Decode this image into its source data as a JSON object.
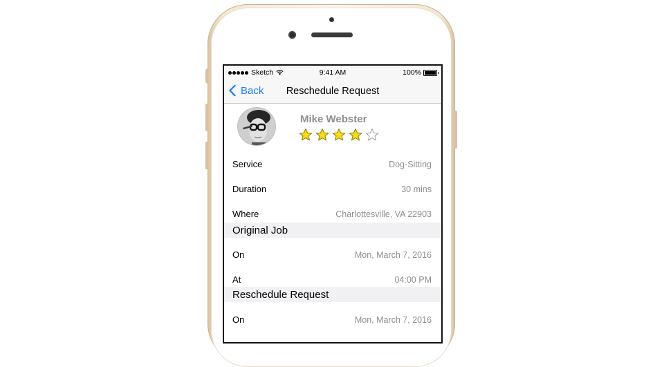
{
  "status_bar": {
    "carrier": "Sketch",
    "time": "9:41 AM",
    "battery": "100%"
  },
  "nav": {
    "back_label": "Back",
    "title": "Reschedule Request"
  },
  "profile": {
    "name": "Mike Webster",
    "rating": 4,
    "rating_max": 5,
    "star_color": "#f5de19"
  },
  "details": [
    {
      "label": "Service",
      "value": "Dog-Sitting"
    },
    {
      "label": "Duration",
      "value": "30 mins"
    },
    {
      "label": "Where",
      "value": "Charlottesville, VA 22903"
    }
  ],
  "original_job": {
    "header": "Original Job",
    "rows": [
      {
        "label": "On",
        "value": "Mon, March 7, 2016"
      },
      {
        "label": "At",
        "value": "04:00 PM"
      }
    ]
  },
  "reschedule_request": {
    "header": "Reschedule Request",
    "rows": [
      {
        "label": "On",
        "value": "Mon, March 7, 2016"
      }
    ]
  },
  "colors": {
    "accent": "#1a7ef5",
    "secondary_text": "#8e8e93",
    "phone_gold": "#e9d6b9"
  }
}
